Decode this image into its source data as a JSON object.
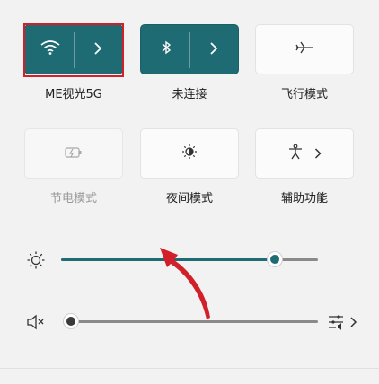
{
  "tiles": {
    "wifi": {
      "label": "ME视光5G",
      "icon": "wifi-icon",
      "expand_icon": "chevron-right-icon"
    },
    "bluetooth": {
      "label": "未连接",
      "icon": "bluetooth-icon",
      "expand_icon": "chevron-right-icon"
    },
    "airplane": {
      "label": "飞行模式",
      "icon": "airplane-icon"
    },
    "battery_saver": {
      "label": "节电模式",
      "icon": "battery-saver-icon"
    },
    "night_light": {
      "label": "夜间模式",
      "icon": "night-light-icon"
    },
    "accessibility": {
      "label": "辅助功能",
      "icon": "accessibility-icon",
      "expand_icon": "chevron-right-icon"
    }
  },
  "brightness": {
    "icon": "brightness-icon",
    "level_fraction": 0.84
  },
  "volume": {
    "icon": "speaker-muted-icon",
    "level_fraction": 0.0,
    "output_icon": "audio-output-icon"
  },
  "colors": {
    "accent": "#1f6b73",
    "annotation_red": "#d2202a"
  }
}
